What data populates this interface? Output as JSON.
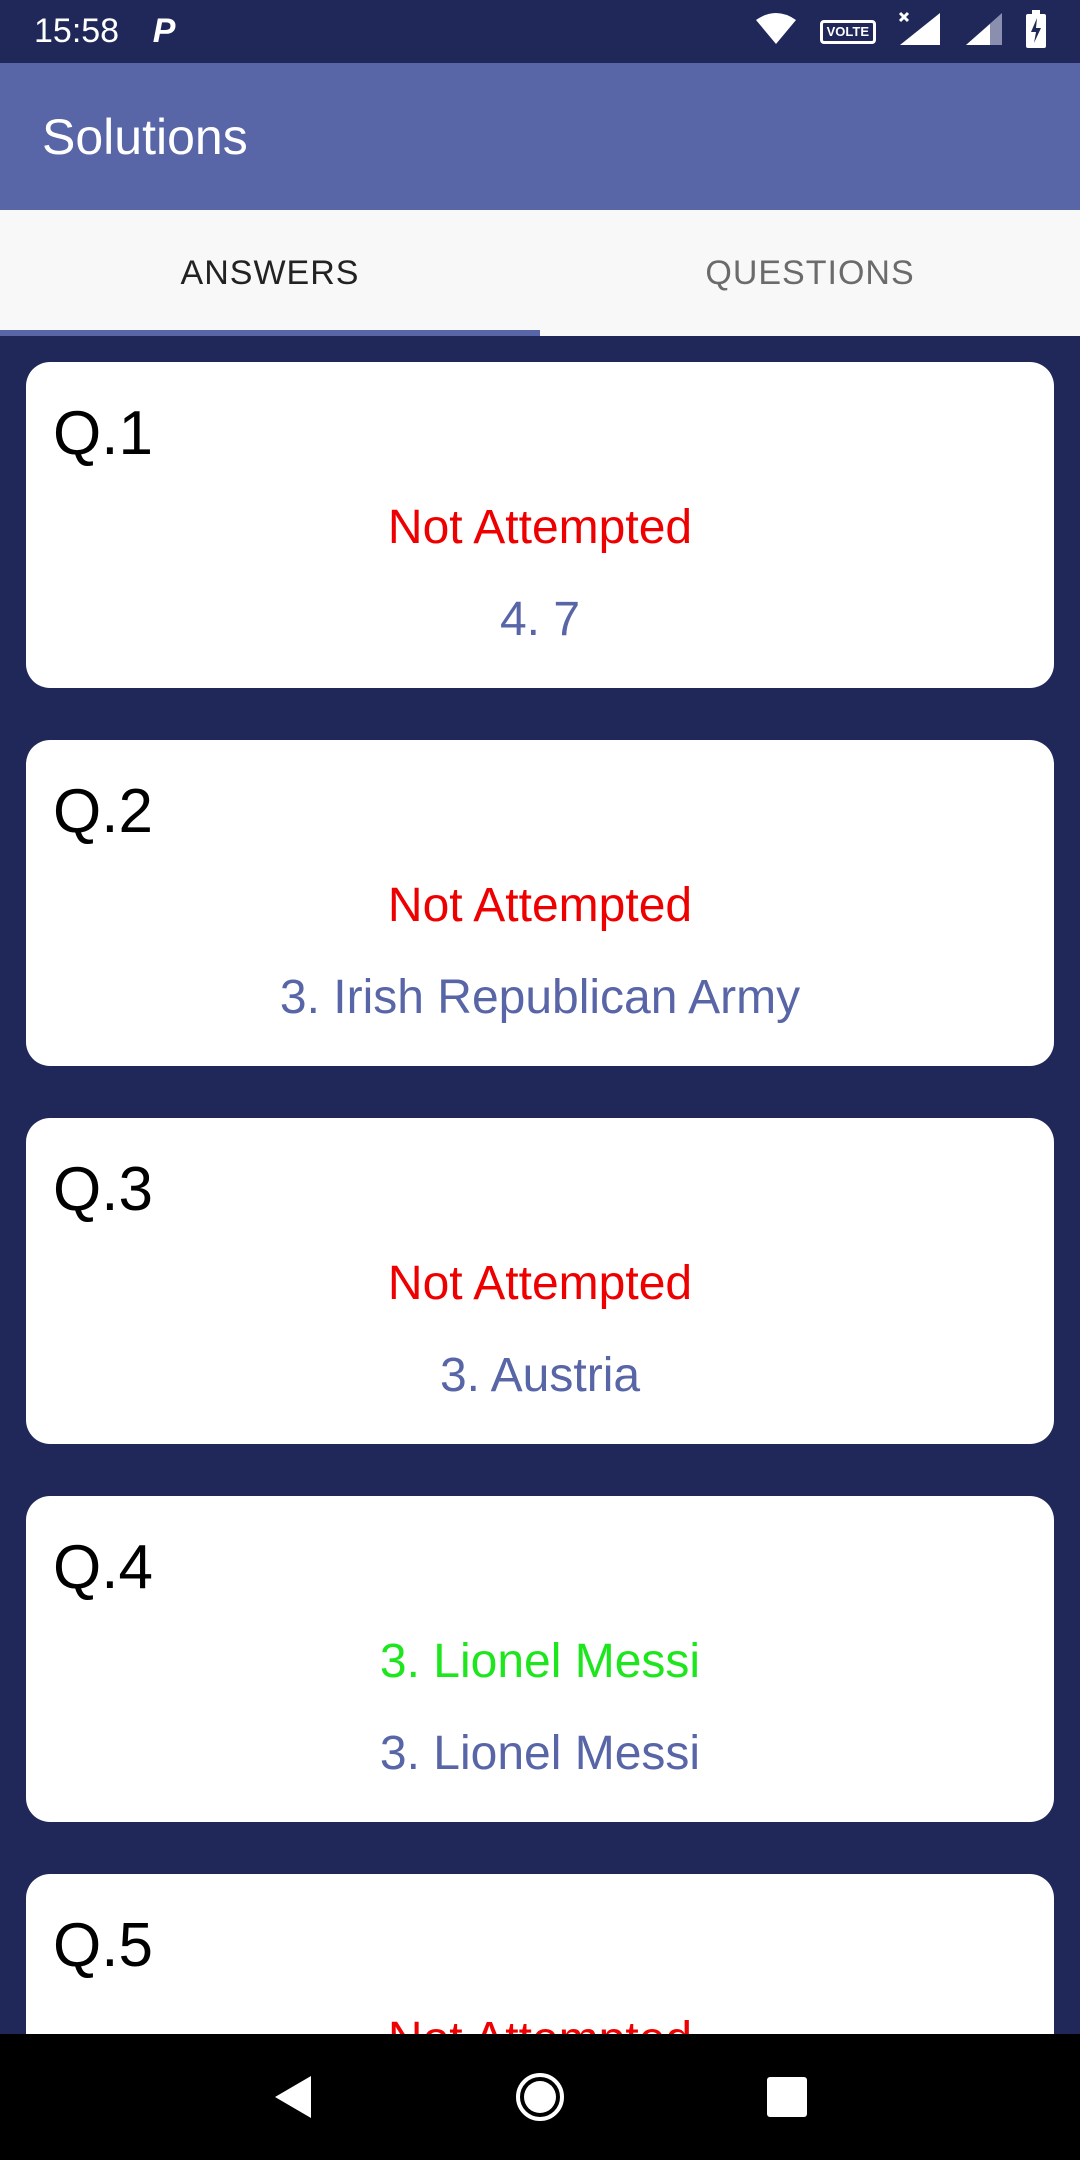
{
  "status_bar": {
    "time": "15:58",
    "notification_icon": "P",
    "volte_label": "VOLTE",
    "icons": [
      "wifi-icon",
      "volte-icon",
      "signal-icon",
      "signal-icon",
      "battery-charging-icon"
    ]
  },
  "app_bar": {
    "title": "Solutions"
  },
  "tabs": [
    {
      "label": "ANSWERS",
      "active": true
    },
    {
      "label": "QUESTIONS",
      "active": false
    }
  ],
  "cards": [
    {
      "label": "Q.1",
      "status": "Not Attempted",
      "status_color": "#ee0000",
      "answer": "4. 7"
    },
    {
      "label": "Q.2",
      "status": "Not Attempted",
      "status_color": "#ee0000",
      "answer": "3. Irish Republican Army"
    },
    {
      "label": "Q.3",
      "status": "Not Attempted",
      "status_color": "#ee0000",
      "answer": "3. Austria"
    },
    {
      "label": "Q.4",
      "status": "3. Lionel Messi",
      "status_color": "#1ee61e",
      "answer": "3. Lionel Messi"
    },
    {
      "label": "Q.5",
      "status": "Not Attempted",
      "status_color": "#ee0000",
      "answer": ""
    }
  ],
  "colors": {
    "background": "#20285a",
    "primary": "#5865a6",
    "answer_text": "#5865a6",
    "not_attempted": "#ee0000",
    "correct": "#1ee61e"
  },
  "nav": {
    "icons": [
      "back-icon",
      "home-icon",
      "recents-icon"
    ]
  }
}
